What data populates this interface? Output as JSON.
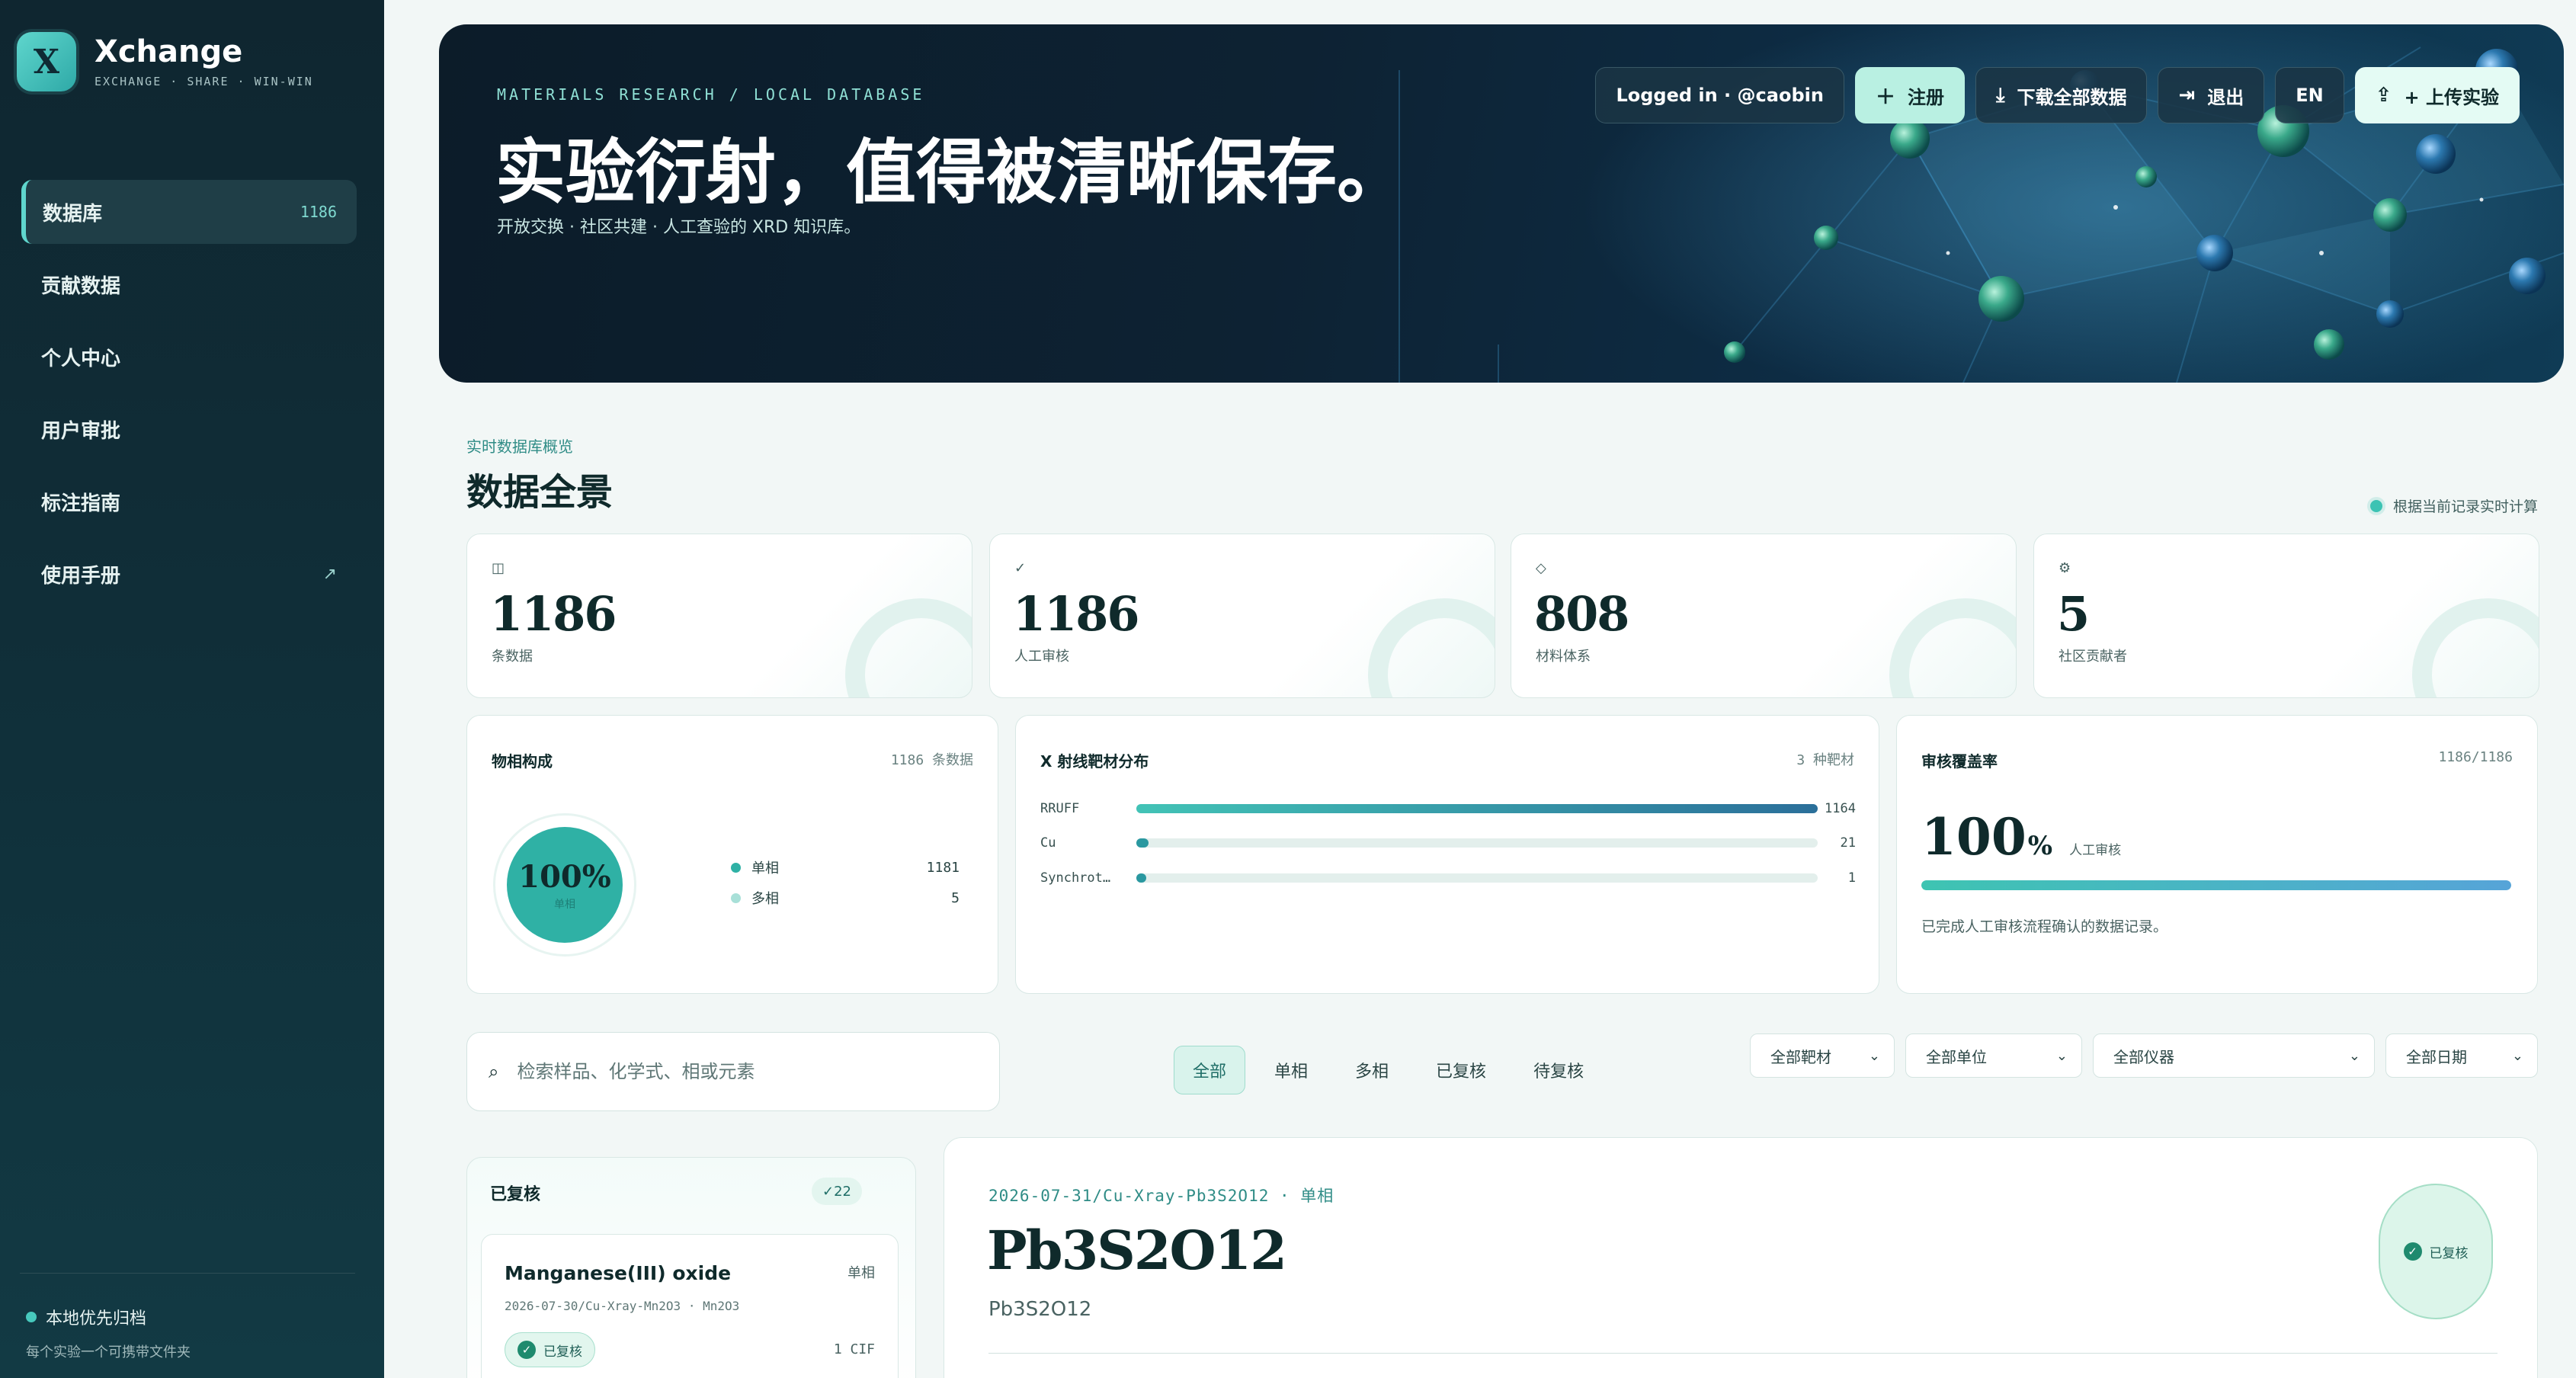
{
  "app": {
    "name": "Xchange",
    "tagline": "EXCHANGE · SHARE · WIN-WIN",
    "logo_letter": "X",
    "accent": "#2fb1a5"
  },
  "sidebar": {
    "items": [
      {
        "label": "数据库",
        "count": "1186",
        "active": true
      },
      {
        "label": "贡献数据"
      },
      {
        "label": "个人中心"
      },
      {
        "label": "用户审批"
      },
      {
        "label": "标注指南"
      },
      {
        "label": "使用手册",
        "ext_icon": "↗"
      }
    ],
    "footer_title": "本地优先归档",
    "footer_sub": "每个实验一个可携带文件夹"
  },
  "hero": {
    "eyebrow": "MATERIALS RESEARCH / LOCAL DATABASE",
    "title": "实验衍射，值得被清晰保存。",
    "subtitle": "开放交换 · 社区共建 · 人工查验的 XRD 知识库。",
    "actions": {
      "logged_in": "Logged in · @caobin",
      "register": "注册",
      "download": "下载全部数据",
      "logout": "退出",
      "lang": "EN",
      "upload": "+ 上传实验"
    }
  },
  "overview": {
    "eyebrow": "实时数据库概览",
    "title": "数据全景",
    "live_note": "根据当前记录实时计算",
    "stats": [
      {
        "icon": "◫",
        "value": "1186",
        "label": "条数据"
      },
      {
        "icon": "✓",
        "value": "1186",
        "label": "人工审核"
      },
      {
        "icon": "◇",
        "value": "808",
        "label": "材料体系"
      },
      {
        "icon": "⚙",
        "value": "5",
        "label": "社区贡献者"
      }
    ]
  },
  "phase_card": {
    "title": "物相构成",
    "meta": "1186 条数据",
    "donut_value": "100%",
    "donut_label": "单相",
    "legend": [
      {
        "label": "单相",
        "value": "1181",
        "color": "#2fb1a5"
      },
      {
        "label": "多相",
        "value": "5",
        "color": "#a8e0d8"
      }
    ]
  },
  "target_card": {
    "title": "X 射线靶材分布",
    "meta": "3 种靶材",
    "max": 1164,
    "rows": [
      {
        "label": "RRUFF",
        "value": 1164
      },
      {
        "label": "Cu",
        "value": 21
      },
      {
        "label": "Synchrot…",
        "value": 1
      }
    ]
  },
  "coverage_card": {
    "title": "审核覆盖率",
    "meta": "1186/1186",
    "value": "100",
    "percent_sign": "%",
    "label": "人工审核",
    "fraction": 1.0,
    "note": "已完成人工审核流程确认的数据记录。"
  },
  "filters": {
    "search_placeholder": "检索样品、化学式、相或元素",
    "chips": [
      {
        "label": "全部",
        "active": true
      },
      {
        "label": "单相"
      },
      {
        "label": "多相"
      },
      {
        "label": "已复核"
      },
      {
        "label": "待复核"
      }
    ],
    "selects": [
      "全部靶材",
      "全部单位",
      "全部仪器",
      "全部日期"
    ]
  },
  "list": {
    "header": "已复核",
    "count": "22",
    "item": {
      "name": "Manganese(III) oxide",
      "type": "单相",
      "path": "2026-07-30/Cu-Xray-Mn2O3 · Mn2O3",
      "status": "已复核",
      "cif": "1 CIF"
    }
  },
  "detail": {
    "path": "2026-07-31/Cu-Xray-Pb3S2O12 · 单相",
    "title": "Pb3S2O12",
    "formula": "Pb3S2O12",
    "status": "已复核"
  }
}
